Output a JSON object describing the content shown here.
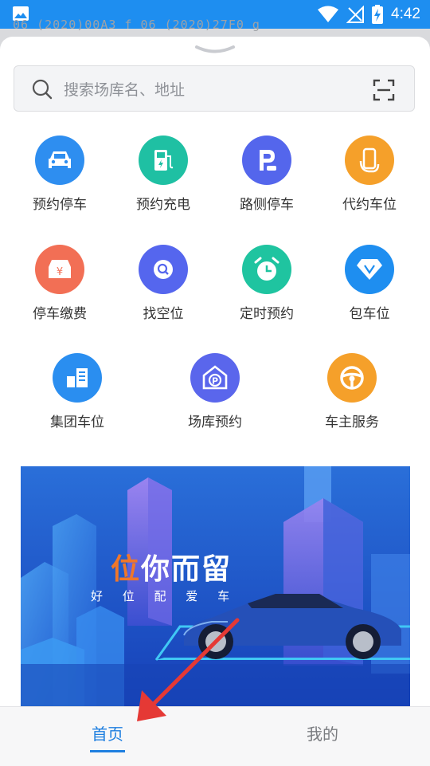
{
  "status_bar": {
    "time": "4:42"
  },
  "background_text": "06 (2020)00A3 f 06 (2020)27F0 g",
  "search": {
    "placeholder": "搜索场库名、地址"
  },
  "services": [
    {
      "label": "预约停车",
      "icon": "car-icon",
      "color": "#2e8ef0"
    },
    {
      "label": "预约充电",
      "icon": "charging-station-icon",
      "color": "#1fc0a3"
    },
    {
      "label": "路侧停车",
      "icon": "parking-p-icon",
      "color": "#5466ec"
    },
    {
      "label": "代约车位",
      "icon": "phone-hand-icon",
      "color": "#f5a02a"
    },
    {
      "label": "停车缴费",
      "icon": "yen-card-icon",
      "color": "#f26f55"
    },
    {
      "label": "找空位",
      "icon": "search-spot-icon",
      "color": "#5566ee"
    },
    {
      "label": "定时预约",
      "icon": "alarm-clock-icon",
      "color": "#1fc4a0"
    },
    {
      "label": "包车位",
      "icon": "diamond-icon",
      "color": "#1e8ef0"
    },
    {
      "label": "集团车位",
      "icon": "building-icon",
      "color": "#2a8ef0"
    },
    {
      "label": "场库预约",
      "icon": "garage-p-icon",
      "color": "#5a66ec"
    },
    {
      "label": "车主服务",
      "icon": "steering-wheel-icon",
      "color": "#f5a02a"
    }
  ],
  "banner": {
    "headline_highlight": "位",
    "headline_rest": "你而留",
    "subtitle": "好 位 配 爱 车",
    "colors": {
      "highlight": "#f0772a",
      "sky": "#1b4fc4"
    }
  },
  "bottom_nav": {
    "tabs": [
      {
        "label": "首页",
        "active": true
      },
      {
        "label": "我的",
        "active": false
      }
    ],
    "accent": "#1e7fe0"
  }
}
